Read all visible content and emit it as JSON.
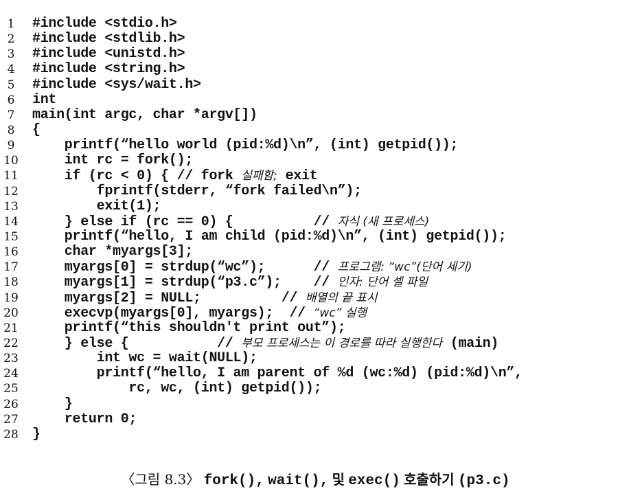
{
  "listing": {
    "lines": [
      {
        "n": "1",
        "code": "#include <stdio.h>"
      },
      {
        "n": "2",
        "code": "#include <stdlib.h>"
      },
      {
        "n": "3",
        "code": "#include <unistd.h>"
      },
      {
        "n": "4",
        "code": "#include <string.h>"
      },
      {
        "n": "5",
        "code": "#include <sys/wait.h>"
      },
      {
        "n": "6",
        "code": "int"
      },
      {
        "n": "7",
        "code": "main(int argc, char *argv[])"
      },
      {
        "n": "8",
        "code": "{"
      },
      {
        "n": "9",
        "code": "    printf(“hello world (pid:%d)\\n”, (int) getpid());"
      },
      {
        "n": "10",
        "code": "    int rc = fork();"
      },
      {
        "n": "11",
        "code": "    if (rc < 0) { // fork ",
        "comment": "실패함;",
        "tail": " exit"
      },
      {
        "n": "12",
        "code": "        fprintf(stderr, “fork failed\\n”);"
      },
      {
        "n": "13",
        "code": "        exit(1);"
      },
      {
        "n": "14",
        "code": "    } else if (rc == 0) {          // ",
        "comment": "자식 (새 프로세스)"
      },
      {
        "n": "15",
        "code": "    printf(“hello, I am child (pid:%d)\\n”, (int) getpid());"
      },
      {
        "n": "16",
        "code": "    char *myargs[3];"
      },
      {
        "n": "17",
        "code": "    myargs[0] = strdup(“wc”);      // ",
        "comment": "프로그램: “wc”(단어 세기)"
      },
      {
        "n": "18",
        "code": "    myargs[1] = strdup(“p3.c”);    // ",
        "comment": "인자: 단어 셀 파일"
      },
      {
        "n": "19",
        "code": "    myargs[2] = NULL;          // ",
        "comment": "배열의 끝 표시"
      },
      {
        "n": "20",
        "code": "    execvp(myargs[0], myargs);  // ",
        "comment": "“wc” 실행"
      },
      {
        "n": "21",
        "code": "    printf(“this shouldn't print out”);"
      },
      {
        "n": "22",
        "code": "    } else {           // ",
        "comment": "부모 프로세스는 이 경로를 따라 실행한다",
        "tail": " (main)"
      },
      {
        "n": "23",
        "code": "        int wc = wait(NULL);"
      },
      {
        "n": "24",
        "code": "        printf(“hello, I am parent of %d (wc:%d) (pid:%d)\\n”,"
      },
      {
        "n": "25",
        "code": "            rc, wc, (int) getpid());"
      },
      {
        "n": "26",
        "code": "    }"
      },
      {
        "n": "27",
        "code": "    return 0;"
      },
      {
        "n": "28",
        "code": "}"
      }
    ]
  },
  "caption": {
    "label": "〈그림 8.3〉",
    "fork": "fork(),",
    "wait": "wait(),",
    "and": "및",
    "exec": "exec()",
    "call": "호출하기",
    "file": "(p3.c)"
  }
}
